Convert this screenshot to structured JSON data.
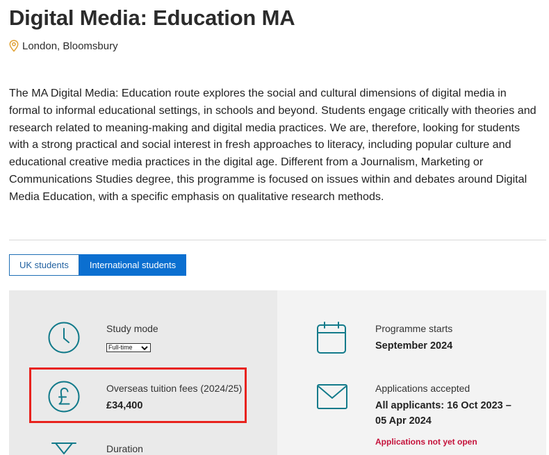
{
  "page": {
    "title": "Digital Media: Education MA",
    "location": "London, Bloomsbury"
  },
  "intro": "The MA Digital Media: Education route explores the social and cultural dimensions of digital media in formal to informal educational settings, in schools and beyond. Students engage critically with theories and research related to meaning-making and digital media practices. We are, therefore, looking for students with a strong practical and social interest in fresh approaches to literacy, including popular culture and educational creative media practices in the digital age. Different from a Journalism, Marketing or Communications Studies degree, this programme is focused on issues within and debates around Digital Media Education, with a specific emphasis on qualitative research methods.",
  "tabs": [
    {
      "label": "UK students",
      "active": false
    },
    {
      "label": "International students",
      "active": true
    }
  ],
  "facts": {
    "study_mode": {
      "label": "Study mode",
      "value": "Full-time"
    },
    "fees": {
      "label": "Overseas tuition fees (2024/25)",
      "value": "£34,400"
    },
    "duration": {
      "label": "Duration"
    },
    "programme_starts": {
      "label": "Programme starts",
      "value": "September 2024"
    },
    "applications": {
      "label": "Applications accepted",
      "value_line1": "All applicants: 16 Oct 2023 –",
      "value_line2": "05 Apr 2024",
      "status": "Applications not yet open"
    }
  },
  "icons": {
    "location": "map-pin-icon",
    "study_mode": "clock-icon",
    "fees": "pound-icon",
    "duration": "hourglass-icon",
    "programme_starts": "calendar-icon",
    "applications": "envelope-icon"
  },
  "colors": {
    "accent": "#0b6fd0",
    "icon_teal": "#127a8a",
    "location_pin": "#e0a233",
    "status_red": "#c4123b",
    "highlight": "#e8231e"
  }
}
